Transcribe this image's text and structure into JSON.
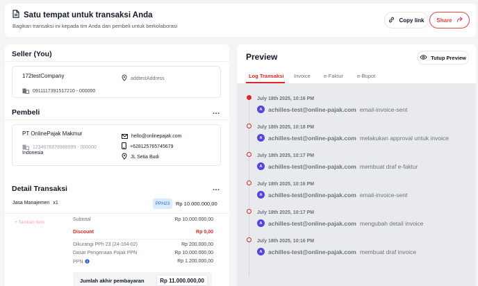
{
  "header": {
    "title": "Satu tempat untuk transaksi Anda",
    "subtitle": "Bagikan transaksi ini kepada tim Anda dan pembeli untuk berkolaborasi",
    "copy_label": "Copy link",
    "share_label": "Share"
  },
  "seller": {
    "title": "Seller (You)",
    "company": "172testCompany",
    "address": "addtestAddress",
    "npwp": "0911117391517210 - 000000"
  },
  "buyer": {
    "title": "Pembeli",
    "menu": "...",
    "company": "PT OnlinePajak Makmur",
    "npwp": "1234676878988999 - 000000",
    "country": "Indonesia",
    "email": "hello@onlinepajak.com",
    "phone": "+628125765745679",
    "address": "JL Setia Budi"
  },
  "detail": {
    "title": "Detail Transaksi",
    "menu": "...",
    "item_name": "Jasa Manajemen",
    "item_qty": "x1",
    "item_badge": "PPH23",
    "item_price": "Rp 10.000.000,00",
    "add_item_label": "+ Tambah Item",
    "rows": [
      {
        "label": "Subtotal",
        "value": "Rp 10.000.000,00"
      },
      {
        "label": "Discount",
        "value": "Rp 0,00"
      },
      {
        "label": "Dikurangi PPh 23 (24-104-02)",
        "value": "Rp 200.000,00"
      },
      {
        "label": "Dasar Pengenaan Pajak PPN",
        "value": "Rp 10.000.000,00"
      },
      {
        "label": "PPN",
        "value": "Rp 1.200.000,00"
      }
    ],
    "total_label": "Jumlah akhir pembayaran",
    "total_value": "Rp 11.000.000,00"
  },
  "preview": {
    "title": "Preview",
    "close_label": "Tutup Preview",
    "tabs": [
      "Log Transaksi",
      "Invoice",
      "e-Faktur",
      "e-Bupot"
    ],
    "active_tab": "Log Transaksi",
    "events": [
      {
        "time": "July 18th 2025, 10:16 PM",
        "user": "achilles-test@online-pajak.com",
        "action": "email-invoice-sent",
        "avatar": "A"
      },
      {
        "time": "July 18th 2025, 10:18 PM",
        "user": "achilles-test@online-pajak.com",
        "action": "melakukan approval untuk invoice",
        "avatar": "A"
      },
      {
        "time": "July 18th 2025, 10:17 PM",
        "user": "achilles-test@online-pajak.com",
        "action": "membuat draf e-faktur",
        "avatar": "A"
      },
      {
        "time": "July 18th 2025, 10:16 PM",
        "user": "achilles-test@online-pajak.com",
        "action": "email-invoice-sent",
        "avatar": "A"
      },
      {
        "time": "July 18th 2025, 10:17 PM",
        "user": "achilles-test@online-pajak.com",
        "action": "mengubah detail invoice",
        "avatar": "A"
      },
      {
        "time": "July 18th 2025, 10:16 PM",
        "user": "achilles-test@online-pajak.com",
        "action": "membuat draf invoice",
        "avatar": "A"
      }
    ]
  },
  "colors": {
    "accent": "#dc2626",
    "badge_bg": "#dbeafe",
    "badge_text": "#2563eb",
    "avatar": "#4f46e5"
  }
}
